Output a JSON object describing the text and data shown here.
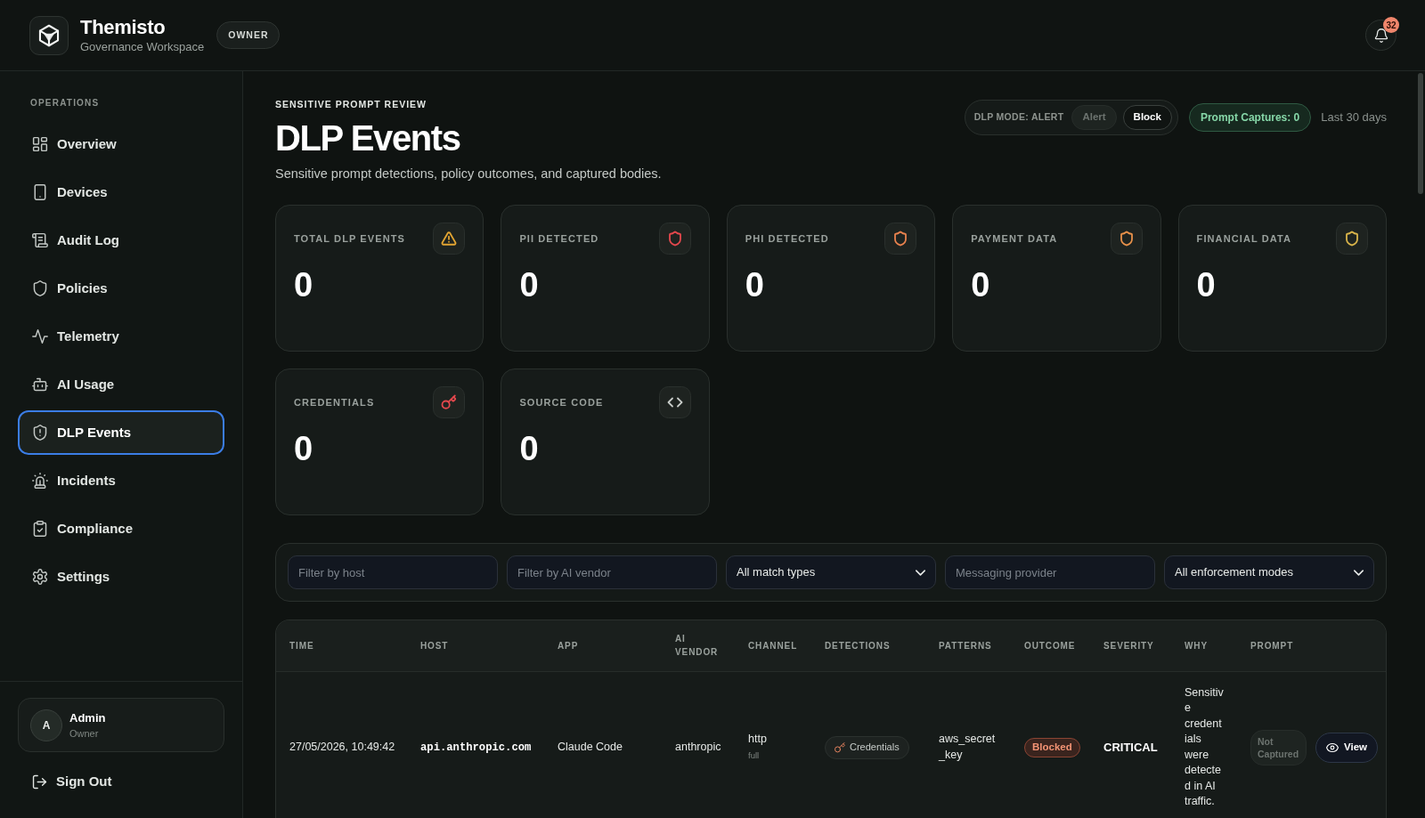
{
  "app": {
    "title": "Themisto",
    "subtitle": "Governance Workspace",
    "role_badge": "OWNER",
    "notifications": {
      "count": "32"
    }
  },
  "sidebar": {
    "section_label": "OPERATIONS",
    "items": [
      {
        "label": "Overview",
        "selected": false
      },
      {
        "label": "Devices",
        "selected": false
      },
      {
        "label": "Audit Log",
        "selected": false
      },
      {
        "label": "Policies",
        "selected": false
      },
      {
        "label": "Telemetry",
        "selected": false
      },
      {
        "label": "AI Usage",
        "selected": false
      },
      {
        "label": "DLP Events",
        "selected": true
      },
      {
        "label": "Incidents",
        "selected": false
      },
      {
        "label": "Compliance",
        "selected": false
      },
      {
        "label": "Settings",
        "selected": false
      }
    ],
    "user": {
      "initial": "A",
      "name": "Admin",
      "role": "Owner"
    },
    "sign_out": "Sign Out"
  },
  "page": {
    "eyebrow": "SENSITIVE PROMPT REVIEW",
    "title": "DLP Events",
    "description": "Sensitive prompt detections, policy outcomes, and captured bodies.",
    "dlp_mode": {
      "label": "DLP MODE: ALERT",
      "options": [
        {
          "label": "Alert",
          "disabled": true
        },
        {
          "label": "Block",
          "disabled": false
        }
      ]
    },
    "prompt_captures": "Prompt Captures: 0",
    "range": "Last 30 days"
  },
  "cards": [
    {
      "label": "TOTAL DLP EVENTS",
      "value": "0"
    },
    {
      "label": "PII DETECTED",
      "value": "0"
    },
    {
      "label": "PHI DETECTED",
      "value": "0"
    },
    {
      "label": "PAYMENT DATA",
      "value": "0"
    },
    {
      "label": "FINANCIAL DATA",
      "value": "0"
    },
    {
      "label": "CREDENTIALS",
      "value": "0"
    },
    {
      "label": "SOURCE CODE",
      "value": "0"
    }
  ],
  "filters": [
    {
      "kind": "input",
      "placeholder": "Filter by host"
    },
    {
      "kind": "input",
      "placeholder": "Filter by AI vendor"
    },
    {
      "kind": "select",
      "value": "All match types"
    },
    {
      "kind": "input",
      "placeholder": "Messaging provider"
    },
    {
      "kind": "select",
      "value": "All enforcement modes"
    }
  ],
  "table": {
    "columns": [
      "TIME",
      "HOST",
      "APP",
      "AI VENDOR",
      "CHANNEL",
      "DETECTIONS",
      "PATTERNS",
      "OUTCOME",
      "SEVERITY",
      "WHY",
      "PROMPT"
    ],
    "rows": [
      {
        "time": "27/05/2026, 10:49:42",
        "host": "api.anthropic.com",
        "app": "Claude Code",
        "ai_vendor": "anthropic",
        "channel": "http",
        "channel_detail": "full",
        "detections": [
          "Credentials"
        ],
        "patterns": "aws_secret_key",
        "outcome": "Blocked",
        "severity": "CRITICAL",
        "why": "Sensitive credentials were detected in AI traffic.",
        "prompt_status": "Not Captured",
        "action": "View"
      }
    ]
  }
}
